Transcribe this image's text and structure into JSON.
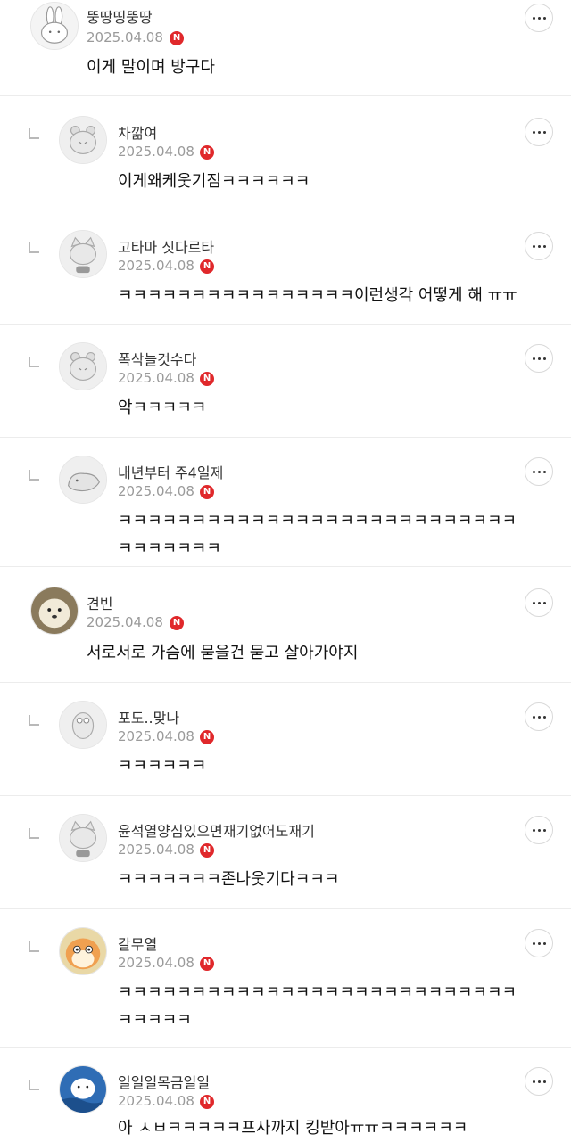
{
  "comments": [
    {
      "nickname": "뚱땅띵뚱땅",
      "date": "2025.04.08",
      "badge": "N",
      "text": "이게 말이며 방구다",
      "reply": false,
      "avatar": "bunny-avatar-icon"
    },
    {
      "nickname": "차깖여",
      "date": "2025.04.08",
      "badge": "N",
      "text": "이게왜케웃기짐ㅋㅋㅋㅋㅋㅋ",
      "reply": true,
      "avatar": "default-bear-avatar-icon"
    },
    {
      "nickname": "고타마 싯다르타",
      "date": "2025.04.08",
      "badge": "N",
      "text": "ㅋㅋㅋㅋㅋㅋㅋㅋㅋㅋㅋㅋㅋㅋㅋㅋ이런생각 어떻게 해 ㅠㅠ",
      "reply": true,
      "avatar": "default-cat-avatar-icon"
    },
    {
      "nickname": "폭삭늘것수다",
      "date": "2025.04.08",
      "badge": "N",
      "text": "악ㅋㅋㅋㅋㅋ",
      "reply": true,
      "avatar": "default-bear-avatar-icon"
    },
    {
      "nickname": "내년부터 주4일제",
      "date": "2025.04.08",
      "badge": "N",
      "text": "ㅋㅋㅋㅋㅋㅋㅋㅋㅋㅋㅋㅋㅋㅋㅋㅋㅋㅋㅋㅋㅋㅋㅋㅋㅋㅋㅋㅋㅋㅋㅋㅋㅋㅋ",
      "reply": true,
      "avatar": "default-seal-avatar-icon"
    },
    {
      "nickname": "견빈",
      "date": "2025.04.08",
      "badge": "N",
      "text": "서로서로 가슴에 묻을건 묻고 살아가야지",
      "reply": false,
      "avatar": "dog-photo-avatar-icon"
    },
    {
      "nickname": "포도..맞나",
      "date": "2025.04.08",
      "badge": "N",
      "text": "ㅋㅋㅋㅋㅋㅋ",
      "reply": true,
      "avatar": "default-bird-avatar-icon"
    },
    {
      "nickname": "윤석열양심있으면재기없어도재기",
      "date": "2025.04.08",
      "badge": "N",
      "text": "ㅋㅋㅋㅋㅋㅋㅋ존나웃기다ㅋㅋㅋ",
      "reply": true,
      "avatar": "default-cat-avatar-icon"
    },
    {
      "nickname": "갈무열",
      "date": "2025.04.08",
      "badge": "N",
      "text": "ㅋㅋㅋㅋㅋㅋㅋㅋㅋㅋㅋㅋㅋㅋㅋㅋㅋㅋㅋㅋㅋㅋㅋㅋㅋㅋㅋㅋㅋㅋㅋㅋ",
      "reply": true,
      "avatar": "hamster-avatar-icon"
    },
    {
      "nickname": "일일일목금일일",
      "date": "2025.04.08",
      "badge": "N",
      "text": "아 ㅅㅂㅋㅋㅋㅋㅋ프사까지 킹받아ㅠㅠㅋㅋㅋㅋㅋㅋ",
      "reply": true,
      "avatar": "seal-blue-avatar-icon"
    }
  ]
}
